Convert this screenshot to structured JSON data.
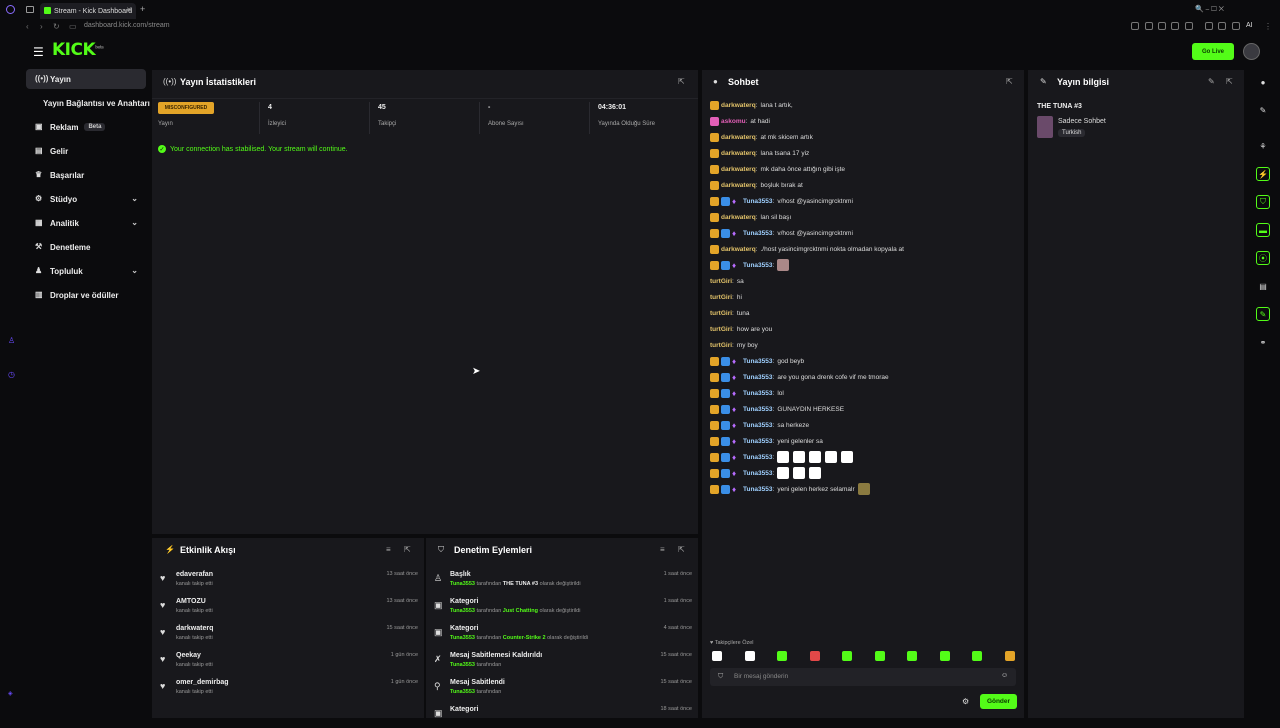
{
  "browser": {
    "tab_title": "Stream - Kick Dashboard",
    "url": "dashboard.kick.com/stream",
    "profile": "AI"
  },
  "header": {
    "logo": "KICK",
    "logo_sup": "beta",
    "go_live": "Go Live"
  },
  "sidebar": {
    "items": [
      {
        "label": "Yayın",
        "icon": "signal-icon"
      },
      {
        "label": "Yayın Bağlantısı ve Anahtarı",
        "icon": ""
      },
      {
        "label": "Reklam",
        "icon": "ad-icon",
        "badge": "Beta"
      },
      {
        "label": "Gelir",
        "icon": "money-icon"
      },
      {
        "label": "Başarılar",
        "icon": "trophy-icon"
      },
      {
        "label": "Stüdyo",
        "icon": "studio-icon"
      },
      {
        "label": "Analitik",
        "icon": "chart-icon"
      },
      {
        "label": "Denetleme",
        "icon": "hammer-icon"
      },
      {
        "label": "Topluluk",
        "icon": "community-icon"
      },
      {
        "label": "Droplar ve ödüller",
        "icon": "gift-icon"
      }
    ]
  },
  "stats": {
    "title": "Yayın İstatistikleri",
    "badge": "MISCONFIGURED",
    "items": [
      {
        "value": "",
        "label": "Yayın"
      },
      {
        "value": "4",
        "label": "İzleyici"
      },
      {
        "value": "45",
        "label": "Takipçi"
      },
      {
        "value": "-",
        "label": "Abone Sayısı"
      },
      {
        "value": "04:36:01",
        "label": "Yayında Olduğu Süre"
      }
    ],
    "connection_message": "Your connection has stabilised. Your stream will continue."
  },
  "chat": {
    "title": "Sohbet",
    "messages": [
      {
        "user": "darkwaterq",
        "text": "lana t artık,",
        "badges": [
          "gold"
        ],
        "color": "gold"
      },
      {
        "user": "askomu",
        "text": "at hadi",
        "badges": [
          "pink"
        ],
        "color": "pink"
      },
      {
        "user": "darkwaterq",
        "text": "at mk skicem artık",
        "badges": [
          "gold"
        ],
        "color": "gold"
      },
      {
        "user": "darkwaterq",
        "text": "lana tsana 17 yiz",
        "badges": [
          "gold"
        ],
        "color": "gold"
      },
      {
        "user": "darkwaterq",
        "text": "mk daha önce attığın gibi işte",
        "badges": [
          "gold"
        ],
        "color": "gold"
      },
      {
        "user": "darkwaterq",
        "text": "boşluk bırak at",
        "badges": [
          "gold"
        ],
        "color": "gold"
      },
      {
        "user": "Tuna3553",
        "text": "v/host @yasincimgrcktnmi",
        "badges": [
          "gold",
          "blue",
          "mic"
        ],
        "color": "blue"
      },
      {
        "user": "darkwaterq",
        "text": "lan sil başı",
        "badges": [
          "gold"
        ],
        "color": "gold"
      },
      {
        "user": "Tuna3553",
        "text": "v/host @yasincimgrcktnmi",
        "badges": [
          "gold",
          "blue",
          "mic"
        ],
        "color": "blue"
      },
      {
        "user": "darkwaterq",
        "text": "./host yasincimgrcktnmi nokta olmadan kopyala at",
        "badges": [
          "gold"
        ],
        "color": "gold"
      },
      {
        "user": "Tuna3553",
        "text": "",
        "badges": [
          "gold",
          "blue",
          "mic"
        ],
        "color": "blue",
        "emotes": [
          "p"
        ]
      },
      {
        "user": "turtGiri",
        "text": "sa",
        "badges": [],
        "color": "gold"
      },
      {
        "user": "turtGiri",
        "text": "hi",
        "badges": [],
        "color": "gold"
      },
      {
        "user": "turtGiri",
        "text": "tuna",
        "badges": [],
        "color": "gold"
      },
      {
        "user": "turtGiri",
        "text": "how are you",
        "badges": [],
        "color": "gold"
      },
      {
        "user": "turtGiri",
        "text": "my boy",
        "badges": [],
        "color": "gold"
      },
      {
        "user": "Tuna3553",
        "text": "god beyb",
        "badges": [
          "gold",
          "blue",
          "mic"
        ],
        "color": "blue"
      },
      {
        "user": "Tuna3553",
        "text": "are you gona drenk cofe vif me tmorae",
        "badges": [
          "gold",
          "blue",
          "mic"
        ],
        "color": "blue"
      },
      {
        "user": "Tuna3553",
        "text": "lol",
        "badges": [
          "gold",
          "blue",
          "mic"
        ],
        "color": "blue"
      },
      {
        "user": "Tuna3553",
        "text": "GUNAYDIN HERKESE",
        "badges": [
          "gold",
          "blue",
          "mic"
        ],
        "color": "blue"
      },
      {
        "user": "Tuna3553",
        "text": "sa herkeze",
        "badges": [
          "gold",
          "blue",
          "mic"
        ],
        "color": "blue"
      },
      {
        "user": "Tuna3553",
        "text": "yeni gelenler sa",
        "badges": [
          "gold",
          "blue",
          "mic"
        ],
        "color": "blue"
      },
      {
        "user": "Tuna3553",
        "text": "",
        "badges": [
          "gold",
          "blue",
          "mic"
        ],
        "color": "blue",
        "emotes": [
          "w",
          "w",
          "w",
          "w",
          "w"
        ]
      },
      {
        "user": "Tuna3553",
        "text": "",
        "badges": [
          "gold",
          "blue",
          "mic"
        ],
        "color": "blue",
        "emotes": [
          "w",
          "w",
          "w"
        ]
      },
      {
        "user": "Tuna3553",
        "text": "yeni gelen herkez selamalr",
        "badges": [
          "gold",
          "blue",
          "mic"
        ],
        "color": "blue",
        "emotes_after": [
          "g"
        ]
      }
    ],
    "followers_only": "Takipçilere Özel",
    "input_placeholder": "Bir mesaj gönderin",
    "send": "Gönder"
  },
  "stream_info": {
    "title": "Yayın bilgisi",
    "stream_title": "THE TUNA #3",
    "category": "Sadece Sohbet",
    "language": "Turkish"
  },
  "activity": {
    "title": "Etkinlik Akışı",
    "items": [
      {
        "name": "edaverafan",
        "sub": "kanalı takip etti",
        "time": "13 saat önce"
      },
      {
        "name": "AMTOZU",
        "sub": "kanalı takip etti",
        "time": "13 saat önce"
      },
      {
        "name": "darkwaterq",
        "sub": "kanalı takip etti",
        "time": "15 saat önce"
      },
      {
        "name": "Qeekay",
        "sub": "kanalı takip etti",
        "time": "1 gün önce"
      },
      {
        "name": "omer_demirbag",
        "sub": "kanalı takip etti",
        "time": "1 gün önce"
      }
    ]
  },
  "moderation": {
    "title": "Denetim Eylemleri",
    "items": [
      {
        "name": "Başlık",
        "actor": "Tuna3553",
        "mid": " tarafından ",
        "value": "THE TUNA #3",
        "end": " olarak değiştirildi",
        "time": "1 saat önce",
        "value_color": "white"
      },
      {
        "name": "Kategori",
        "actor": "Tuna3553",
        "mid": " tarafından ",
        "value": "Just Chatting",
        "end": " olarak değiştirildi",
        "time": "1 saat önce",
        "value_color": "green"
      },
      {
        "name": "Kategori",
        "actor": "Tuna3553",
        "mid": " tarafından ",
        "value": "Counter-Strike 2",
        "end": " olarak değiştirildi",
        "time": "4 saat önce",
        "value_color": "green"
      },
      {
        "name": "Mesaj Sabitlemesi Kaldırıldı",
        "actor": "Tuna3553",
        "mid": " tarafından",
        "value": "",
        "end": "",
        "time": "15 saat önce",
        "value_color": "white"
      },
      {
        "name": "Mesaj Sabitlendi",
        "actor": "Tuna3553",
        "mid": " tarafından",
        "value": "",
        "end": "",
        "time": "15 saat önce",
        "value_color": "white"
      },
      {
        "name": "Kategori",
        "actor": "",
        "mid": "",
        "value": "",
        "end": "",
        "time": "18 saat önce",
        "value_color": "white"
      }
    ]
  },
  "colors": {
    "accent": "#53fc18",
    "warning": "#e3a428",
    "panel": "#18181c",
    "bg": "#0b0b0d"
  }
}
